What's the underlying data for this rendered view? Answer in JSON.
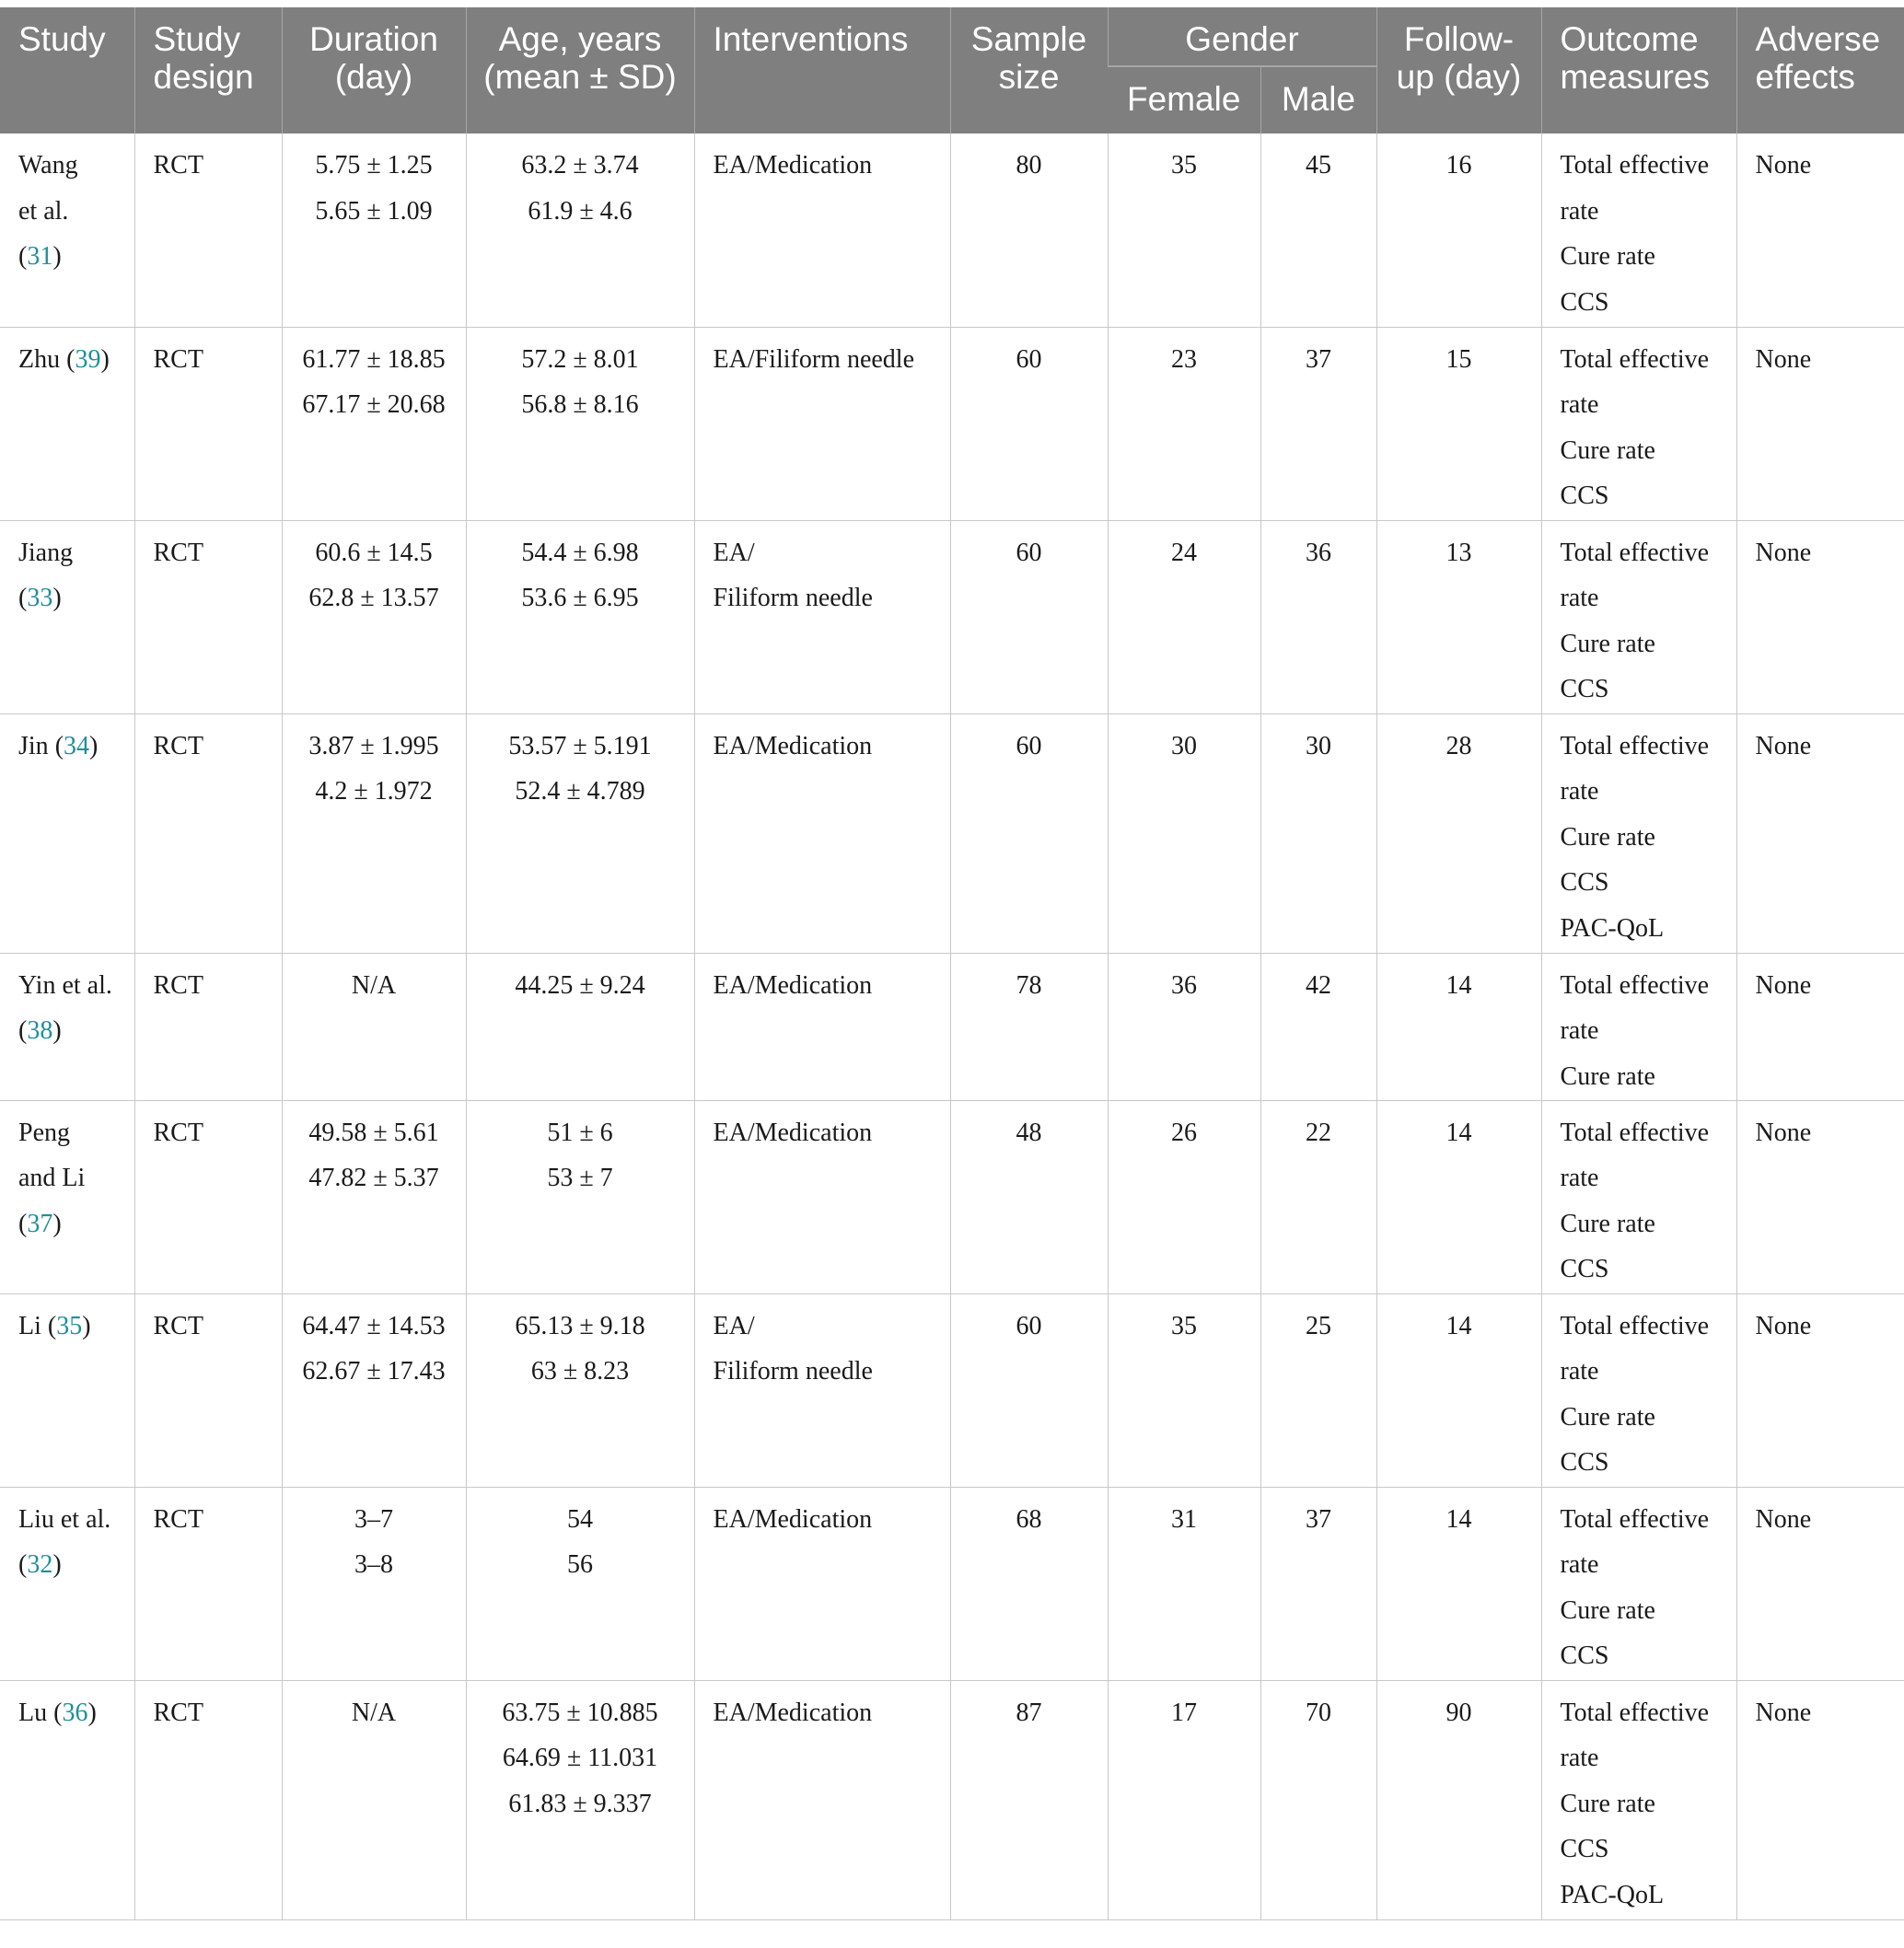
{
  "header": {
    "study": "Study",
    "study_design_1": "Study",
    "study_design_2": "design",
    "duration_1": "Duration",
    "duration_2": "(day)",
    "age_1": "Age, years",
    "age_2": "(mean ± SD)",
    "interventions": "Interventions",
    "sample_1": "Sample",
    "sample_2": "size",
    "gender": "Gender",
    "female": "Female",
    "male": "Male",
    "followup_1": "Follow-",
    "followup_2": "up (day)",
    "outcome_1": "Outcome",
    "outcome_2": "measures",
    "adverse_1": "Adverse",
    "adverse_2": "effects"
  },
  "rows": [
    {
      "study_a": "Wang",
      "study_b": "et al.",
      "study_pre": "(",
      "ref": "31",
      "study_post": ")",
      "design": "RCT",
      "duration": [
        "5.75 ± 1.25",
        "5.65 ± 1.09"
      ],
      "age": [
        "63.2 ± 3.74",
        "61.9 ± 4.6"
      ],
      "interventions": [
        "EA/Medication"
      ],
      "sample": "80",
      "female": "35",
      "male": "45",
      "followup": "16",
      "outcomes": [
        "Total effective",
        "rate",
        "Cure rate",
        "CCS"
      ],
      "adverse": "None"
    },
    {
      "study_a": "Zhu",
      "study_pre": " (",
      "ref": "39",
      "study_post": ")",
      "design": "RCT",
      "duration": [
        "61.77 ± 18.85",
        "67.17 ± 20.68"
      ],
      "age": [
        "57.2 ± 8.01",
        "56.8 ± 8.16"
      ],
      "interventions": [
        "EA/Filiform needle"
      ],
      "sample": "60",
      "female": "23",
      "male": "37",
      "followup": "15",
      "outcomes": [
        "Total effective",
        "rate",
        "Cure rate",
        "CCS"
      ],
      "adverse": "None"
    },
    {
      "study_a": "Jiang",
      "study_pre": "(",
      "ref": "33",
      "study_post": ")",
      "design": "RCT",
      "duration": [
        "60.6 ± 14.5",
        "62.8 ± 13.57"
      ],
      "age": [
        "54.4 ± 6.98",
        "53.6 ± 6.95"
      ],
      "interventions": [
        "EA/",
        "Filiform needle"
      ],
      "sample": "60",
      "female": "24",
      "male": "36",
      "followup": "13",
      "outcomes": [
        "Total effective",
        "rate",
        "Cure rate",
        "CCS"
      ],
      "adverse": "None"
    },
    {
      "study_a": "Jin",
      "study_pre": " (",
      "ref": "34",
      "study_post": ")",
      "design": "RCT",
      "duration": [
        "3.87 ± 1.995",
        "4.2 ± 1.972"
      ],
      "age": [
        "53.57 ± 5.191",
        "52.4 ± 4.789"
      ],
      "interventions": [
        "EA/Medication"
      ],
      "sample": "60",
      "female": "30",
      "male": "30",
      "followup": "28",
      "outcomes": [
        "Total effective",
        "rate",
        "Cure rate",
        "CCS",
        "PAC-QoL"
      ],
      "adverse": "None"
    },
    {
      "study_a": "Yin et al.",
      "study_pre": "(",
      "ref": "38",
      "study_post": ")",
      "design": "RCT",
      "duration": [
        "N/A"
      ],
      "age": [
        "44.25 ± 9.24"
      ],
      "interventions": [
        "EA/Medication"
      ],
      "sample": "78",
      "female": "36",
      "male": "42",
      "followup": "14",
      "outcomes": [
        "Total effective",
        "rate",
        "Cure rate"
      ],
      "adverse": "None"
    },
    {
      "study_a": "Peng",
      "study_b": "and Li",
      "study_pre": "(",
      "ref": "37",
      "study_post": ")",
      "design": "RCT",
      "duration": [
        "49.58 ± 5.61",
        "47.82 ± 5.37"
      ],
      "age": [
        "51 ± 6",
        "53 ± 7"
      ],
      "interventions": [
        "EA/Medication"
      ],
      "sample": "48",
      "female": "26",
      "male": "22",
      "followup": "14",
      "outcomes": [
        "Total effective",
        "rate",
        "Cure rate",
        "CCS"
      ],
      "adverse": "None"
    },
    {
      "study_a": "Li",
      "study_pre": " (",
      "ref": "35",
      "study_post": ")",
      "design": "RCT",
      "duration": [
        "64.47 ± 14.53",
        "62.67 ± 17.43"
      ],
      "age": [
        "65.13 ± 9.18",
        "63 ± 8.23"
      ],
      "interventions": [
        "EA/",
        "Filiform needle"
      ],
      "sample": "60",
      "female": "35",
      "male": "25",
      "followup": "14",
      "outcomes": [
        "Total effective",
        "rate",
        "Cure rate",
        "CCS"
      ],
      "adverse": "None"
    },
    {
      "study_a": "Liu et al.",
      "study_pre": "(",
      "ref": "32",
      "study_post": ")",
      "design": "RCT",
      "duration": [
        "3–7",
        "3–8"
      ],
      "age": [
        "54",
        "56"
      ],
      "interventions": [
        "EA/Medication"
      ],
      "sample": "68",
      "female": "31",
      "male": "37",
      "followup": "14",
      "outcomes": [
        "Total effective",
        "rate",
        "Cure rate",
        "CCS"
      ],
      "adverse": "None"
    },
    {
      "study_a": "Lu",
      "study_pre": " (",
      "ref": "36",
      "study_post": ")",
      "design": "RCT",
      "duration": [
        "N/A"
      ],
      "age": [
        "63.75 ± 10.885",
        "64.69 ± 11.031",
        "61.83 ± 9.337"
      ],
      "interventions": [
        "EA/Medication"
      ],
      "sample": "87",
      "female": "17",
      "male": "70",
      "followup": "90",
      "outcomes": [
        "Total effective",
        "rate",
        "Cure rate",
        "CCS",
        "PAC-QoL"
      ],
      "adverse": "None"
    }
  ]
}
